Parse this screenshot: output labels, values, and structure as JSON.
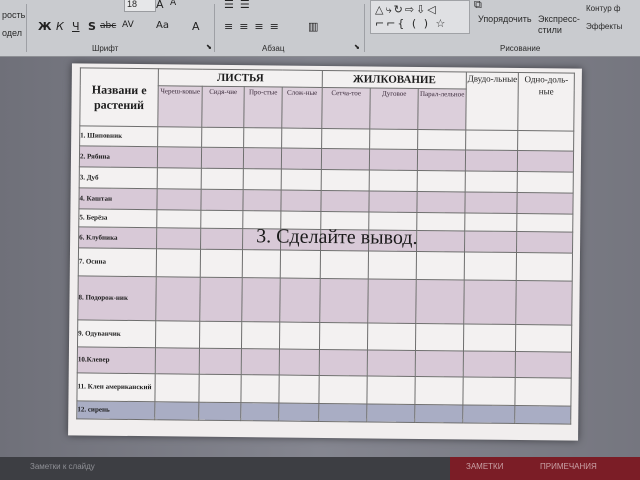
{
  "ribbon": {
    "left_items": [
      "рость",
      "одел"
    ],
    "font_size": "18",
    "format_buttons": [
      "Ж",
      "К",
      "Ч",
      "S",
      "abc",
      "AV",
      "Aa",
      "A"
    ],
    "grow_font": "A",
    "shrink_font": "A",
    "font_group": "Шрифт",
    "para_group": "Абзац",
    "shapes_preview": "△⤷↻⇨⇩◁ ⌐⌐{ ( ) ☆",
    "arrange": "Упорядочить",
    "express_styles": "Экспресс-стили",
    "outline": "Контур ф",
    "effects": "Эффекты",
    "drawing_group": "Рисование"
  },
  "slide": {
    "table": {
      "header_name": "Названи е растений",
      "groups": [
        "ЛИСТЬЯ",
        "ЖИЛКОВАНИЕ"
      ],
      "single_headers": [
        "Двудо-льные",
        "Одно-доль-ные"
      ],
      "leaf_types": [
        "Череш-ковые",
        "Сидя-чие",
        "Про-стые",
        "Слож-ные"
      ],
      "vein_types": [
        "Сетча-тое",
        "Дуговое",
        "Парал-лельное"
      ],
      "plants": [
        "1. Шиповник",
        "2. Рябина",
        "3. Дуб",
        "4. Каштан",
        "5. Берёза",
        "6. Клубника",
        "7. Осина",
        "8. Подорож-ник",
        "9. Одуванчик",
        "10.Клевер",
        "11. Клен американский",
        "12. сирень"
      ]
    },
    "overlay": "3. Сделайте вывод."
  },
  "statusbar": {
    "notes": "Заметки к слайду",
    "right_notes": "ЗАМЕТКИ",
    "right_comments": "ПРИМЕЧАНИЯ"
  }
}
